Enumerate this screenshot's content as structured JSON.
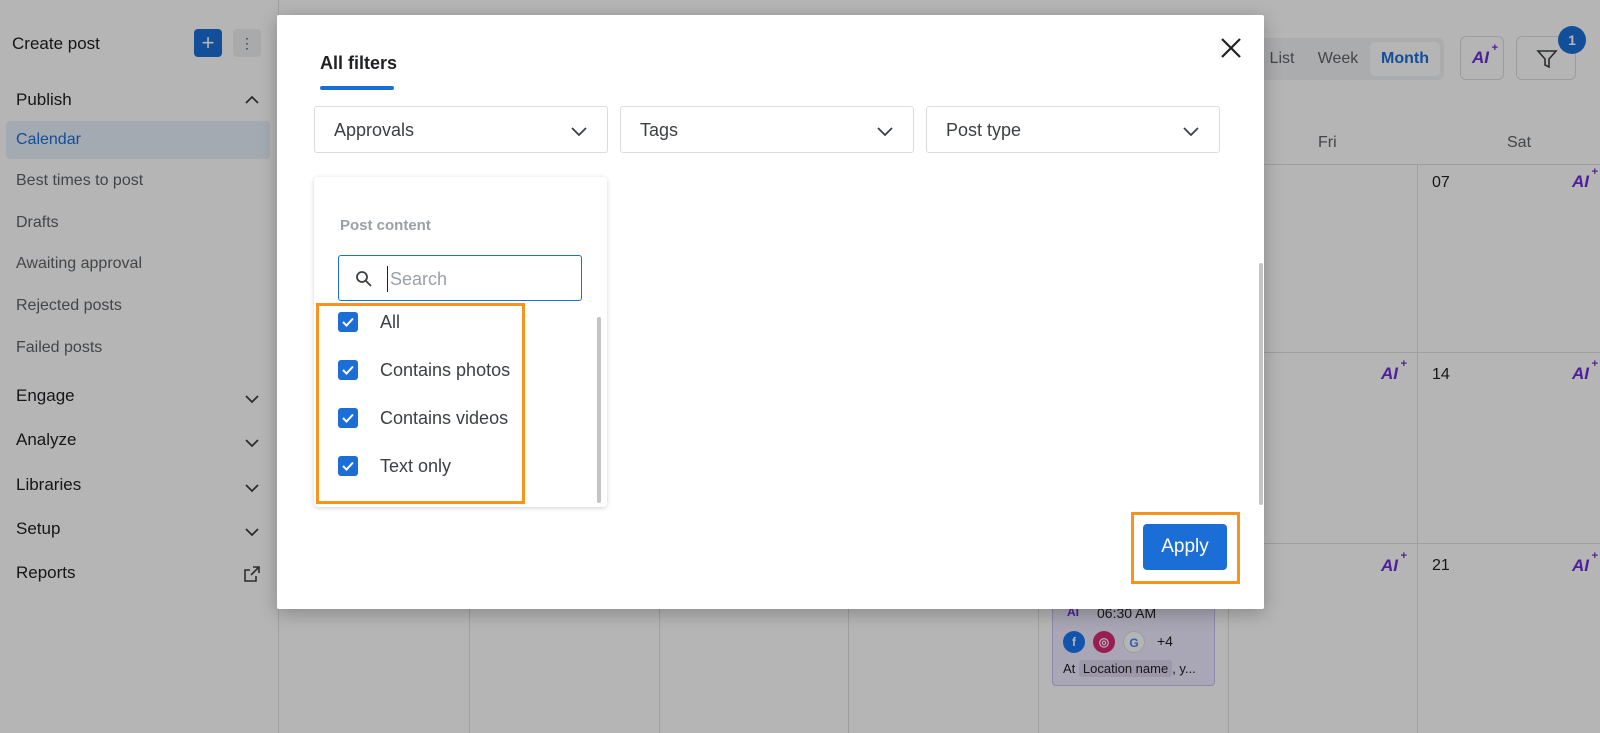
{
  "sidebar": {
    "create_label": "Create post",
    "plus_glyph": "+",
    "more_glyph": "⋮",
    "sections": {
      "publish": "Publish",
      "engage": "Engage",
      "analyze": "Analyze",
      "libraries": "Libraries",
      "setup": "Setup",
      "reports": "Reports"
    },
    "publish_items": [
      "Calendar",
      "Best times to post",
      "Drafts",
      "Awaiting approval",
      "Rejected posts",
      "Failed posts"
    ]
  },
  "calendar": {
    "views": [
      "List",
      "Week",
      "Month"
    ],
    "selected_view": "Month",
    "ai_label": "AI",
    "ai_spark": "+",
    "filter_count": "1",
    "day_headers": [
      "Fri",
      "Sat"
    ],
    "dates": [
      "07",
      "14",
      "21"
    ],
    "post": {
      "ai_label": "AI",
      "time": "06:30 AM",
      "more_networks": "+4",
      "location_prefix": "At",
      "location_name": "Location name",
      "location_suffix": ", y..."
    }
  },
  "modal": {
    "tab_label": "All filters",
    "dropdowns": [
      "Approvals",
      "Tags",
      "Post type"
    ],
    "panel_title": "Post content",
    "search_placeholder": "Search",
    "options": [
      "All",
      "Contains photos",
      "Contains videos",
      "Text only"
    ],
    "options_checked": [
      true,
      true,
      true,
      true
    ],
    "apply_label": "Apply"
  },
  "colors": {
    "accent": "#1b6ed6",
    "highlight": "#f7941d",
    "ai_purple": "#6b2fd6"
  },
  "icons": {
    "close": "close-icon",
    "chevron": "chevron-down-icon",
    "search": "search-icon",
    "filter": "filter-icon",
    "external": "external-link-icon",
    "check": "check-icon"
  }
}
